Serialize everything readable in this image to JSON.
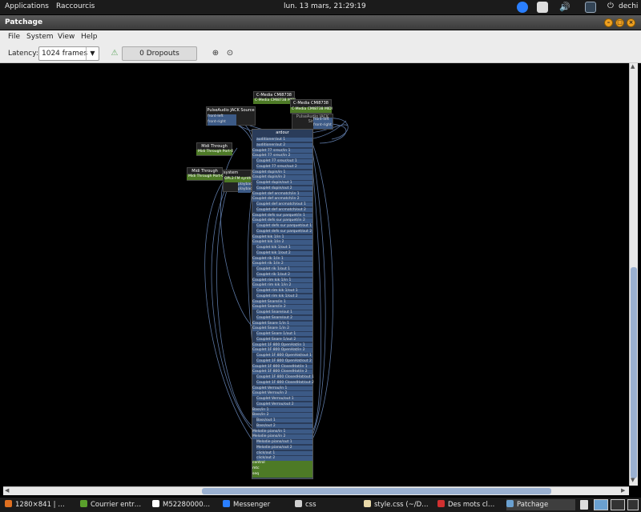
{
  "topbar": {
    "applications": "Applications",
    "raccourcis": "Raccourcis",
    "clock": "lun. 13 mars, 21:29:19",
    "user": "dechi",
    "tray_icons": [
      "messenger-icon",
      "notification-icon",
      "volume-icon",
      "network-icon"
    ]
  },
  "window": {
    "title": "Patchage"
  },
  "menu": {
    "file": "File",
    "system": "System",
    "view": "View",
    "help": "Help"
  },
  "toolbar": {
    "latency_label": "Latency:",
    "latency_value": "1024 frames",
    "dropouts": "0 Dropouts",
    "icons": [
      "clear-dropouts-icon",
      "zoom-in-icon",
      "zoom-normal-icon"
    ]
  },
  "graph": {
    "cmedia1": {
      "title": "C-Media CMI8738",
      "port": "C-Media CMI8738 MIDI"
    },
    "cmedia2": {
      "title": "C-Media CMI8738",
      "port": "C-Media CMI8738 MIDI"
    },
    "pulse_source": {
      "title": "PulseAudio JACK Source",
      "ports": [
        "front-left",
        "front-right"
      ]
    },
    "pulse_sink": {
      "title": "PulseAudio JACK Sink",
      "ports": [
        "front-left",
        "front-right"
      ]
    },
    "midi1": {
      "title": "Midi Through",
      "port": "Midi Through Port-0"
    },
    "midi2": {
      "title": "Midi Through",
      "port": "Midi Through Port-0"
    },
    "system_small": {
      "title": "system",
      "ports": [
        "OPL3 FM synth",
        "playback_1",
        "playback_2"
      ]
    },
    "ardour": {
      "title": "ardour",
      "ports": [
        "auditioner/out 1",
        "auditioner/out 2",
        "Couplet 77 sreur/in 1",
        "Couplet 77 sreur/in 2",
        "Couplet 77 sreur/out 1",
        "Couplet 77 sreur/out 2",
        "Couplet dupin/in 1",
        "Couplet dupin/in 2",
        "Couplet dupin/out 1",
        "Couplet dupin/out 2",
        "Couplet def arcmatch/in 1",
        "Couplet def arcmatch/in 2",
        "Couplet def arcmatch/out 1",
        "Couplet def arcmatch/out 2",
        "Couplet defs sur parquet/in 1",
        "Couplet defs sur parquet/in 2",
        "Couplet defs sur parquet/out 1",
        "Couplet defs sur parquet/out 2",
        "Couplet kik 1/in 1",
        "Couplet kik 1/in 2",
        "Couplet kik 1/out 1",
        "Couplet kik 1/out 2",
        "Couplet rik 1/in 1",
        "Couplet rik 1/in 2",
        "Couplet rik 1/out 1",
        "Couplet rik 1/out 2",
        "Couplet rim kik 1/in 1",
        "Couplet rim kik 1/in 2",
        "Couplet rim kik 1/out 1",
        "Couplet rim kik 1/out 2",
        "Couplet Snare/in 1",
        "Couplet Snare/in 2",
        "Couplet Snare/out 1",
        "Couplet Snare/out 2",
        "Couplet Snare 1/in 1",
        "Couplet Snare 1/in 2",
        "Couplet Snare 1/out 1",
        "Couplet Snare 1/out 2",
        "Couplet 1F 800 OpenHat/in 1",
        "Couplet 1F 800 OpenHat/in 2",
        "Couplet 1F 800 OpenHat/out 1",
        "Couplet 1F 800 OpenHat/out 2",
        "Couplet 1F 800 ClosedHat/in 1",
        "Couplet 1F 800 ClosedHat/in 2",
        "Couplet 1F 800 ClosedHat/out 1",
        "Couplet 1F 800 ClosedHat/out 2",
        "Couplet Verrou/in 1",
        "Couplet Verrou/in 2",
        "Couplet Verrou/out 1",
        "Couplet Verrou/out 2",
        "Bass/in 1",
        "Bass/in 2",
        "Bass/out 1",
        "Bass/out 2",
        "Melodie piano/in 1",
        "Melodie piano/in 2",
        "Melodie piano/out 1",
        "Melodie piano/out 2",
        "click/out 1",
        "click/out 2"
      ],
      "midi_ports": [
        "control",
        "mtc",
        "seq"
      ]
    }
  },
  "taskbar": [
    {
      "label": "1280×841 | …",
      "icon": "firefox-icon",
      "color": "#e07020"
    },
    {
      "label": "Courrier entr…",
      "icon": "mail-icon",
      "color": "#5aa02c"
    },
    {
      "label": "M52280000…",
      "icon": "document-icon",
      "color": "#ffffff"
    },
    {
      "label": "Messenger",
      "icon": "messenger-icon",
      "color": "#2a7fff"
    },
    {
      "label": "css",
      "icon": "folder-icon",
      "color": "#cfcfcf"
    },
    {
      "label": "style.css (~/D…",
      "icon": "text-editor-icon",
      "color": "#e8d8a8"
    },
    {
      "label": "Des mots cl…",
      "icon": "browser-icon",
      "color": "#d03030"
    },
    {
      "label": "Patchage",
      "icon": "patchage-icon",
      "color": "#6aa0d0"
    }
  ],
  "colors": {
    "node_body": "#3c5a86",
    "node_dark": "#222",
    "midi_port": "#4d7a26",
    "wire": "#6c8cc0",
    "highlight": "#9ab0d0"
  }
}
